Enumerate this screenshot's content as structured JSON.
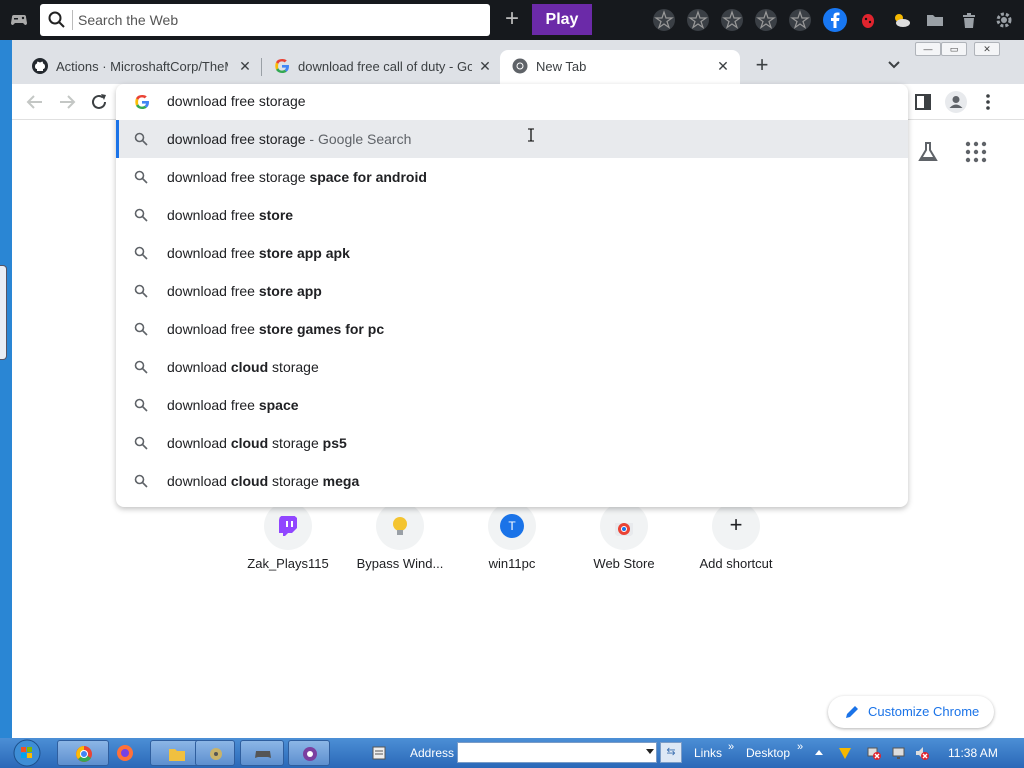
{
  "gamebar": {
    "search_placeholder": "Search the Web",
    "play_label": "Play"
  },
  "tabs": [
    {
      "title": "Actions · MicroshaftCorp/TheMEG",
      "icon": "github-icon"
    },
    {
      "title": "download free call of duty - Google",
      "icon": "google-icon"
    },
    {
      "title": "New Tab",
      "icon": "chrome-icon"
    }
  ],
  "omnibox": {
    "query": "download free storage",
    "suggestions": [
      {
        "plain": "download free storage",
        "bold": "",
        "desc": " - Google Search"
      },
      {
        "plain": "download free storage ",
        "bold": "space for android",
        "desc": ""
      },
      {
        "plain": "download free ",
        "bold": "store",
        "desc": ""
      },
      {
        "plain": "download free ",
        "bold": "store app apk",
        "desc": ""
      },
      {
        "plain": "download free ",
        "bold": "store app",
        "desc": ""
      },
      {
        "plain": "download free ",
        "bold": "store games for pc",
        "desc": ""
      },
      {
        "plain": "download ",
        "bold": "cloud",
        "after": " storage",
        "desc": ""
      },
      {
        "plain": "download free ",
        "bold": "space",
        "desc": ""
      },
      {
        "plain": "download ",
        "bold": "cloud",
        "after": " storage ",
        "bold2": "ps5",
        "desc": ""
      },
      {
        "plain": "download ",
        "bold": "cloud",
        "after": " storage ",
        "bold2": "mega",
        "desc": ""
      }
    ]
  },
  "shortcuts": [
    {
      "label": "Zak_Plays115",
      "color": "#9146ff",
      "letter": ""
    },
    {
      "label": "Bypass Wind...",
      "color": "#f4c430",
      "letter": ""
    },
    {
      "label": "win11pc",
      "color": "#1a73e8",
      "letter": "T"
    },
    {
      "label": "Web Store",
      "color": "#ea4335",
      "letter": ""
    },
    {
      "label": "Add shortcut",
      "color": "",
      "letter": "+"
    }
  ],
  "customize_label": "Customize Chrome",
  "taskbar": {
    "address_label": "Address",
    "links_label": "Links",
    "desktop_label": "Desktop",
    "clock": "11:38 AM"
  }
}
